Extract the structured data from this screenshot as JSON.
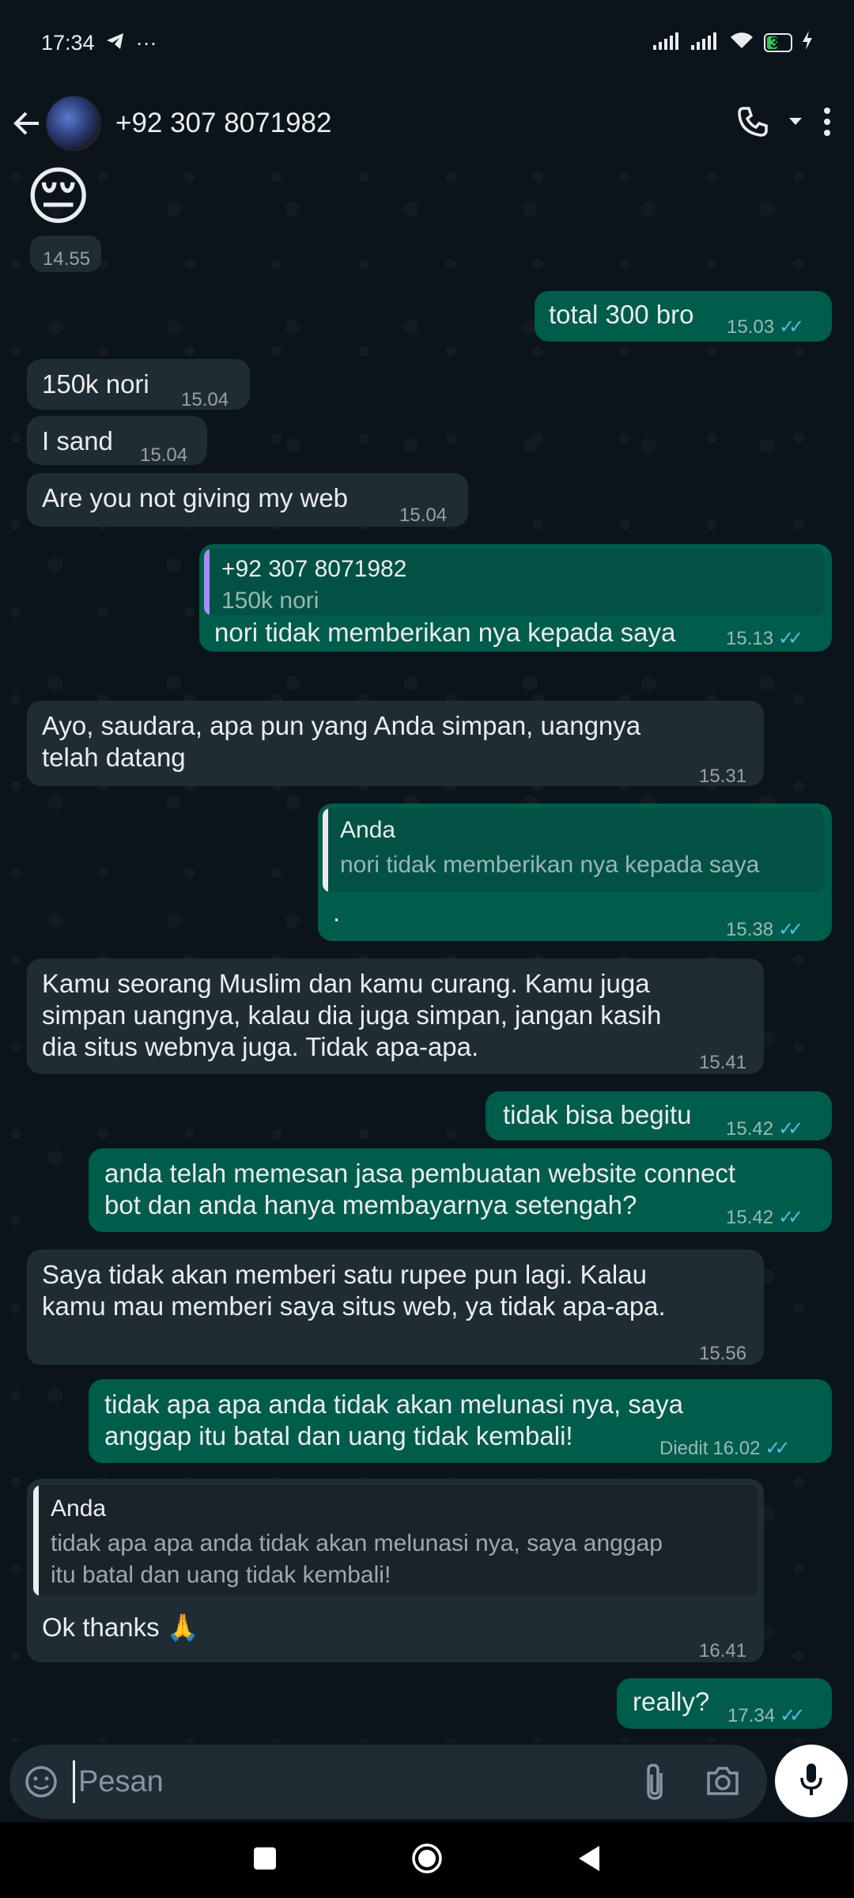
{
  "status": {
    "time": "17:34",
    "more": "···",
    "battery": "33"
  },
  "header": {
    "contact": "+92 307 8071982"
  },
  "messages": {
    "m0": {
      "emoji": "😔",
      "time": "14.55"
    },
    "m1": {
      "text": "total 300 bro",
      "time": "15.03"
    },
    "m2": {
      "text": "150k nori",
      "time": "15.04"
    },
    "m3": {
      "text": "I sand",
      "time": "15.04"
    },
    "m4": {
      "text": "Are you not giving my web",
      "time": "15.04"
    },
    "m5": {
      "quote_author": "+92 307 8071982",
      "quote_text": "150k nori",
      "text": "nori tidak memberikan nya kepada saya",
      "time": "15.13"
    },
    "m6": {
      "text": "Ayo, saudara, apa pun yang Anda simpan, uangnya\ntelah datang",
      "time": "15.31"
    },
    "m7": {
      "quote_author": "Anda",
      "quote_text": "nori tidak memberikan nya kepada saya",
      "text": ".",
      "time": "15.38"
    },
    "m8": {
      "text": "Kamu seorang Muslim dan kamu curang. Kamu juga\nsimpan uangnya, kalau dia juga simpan, jangan kasih\ndia situs webnya juga. Tidak apa-apa.",
      "time": "15.41"
    },
    "m9": {
      "text": "tidak bisa begitu",
      "time": "15.42"
    },
    "m10": {
      "text": "anda telah memesan jasa pembuatan website connect\nbot dan anda hanya membayarnya setengah?",
      "time": "15.42"
    },
    "m11": {
      "text": "Saya tidak akan memberi satu rupee pun lagi. Kalau\nkamu mau memberi saya situs web, ya tidak apa-apa.",
      "time": "15.56"
    },
    "m12": {
      "text": "tidak apa apa anda tidak akan melunasi nya, saya\nanggap itu batal dan uang tidak kembali!",
      "edited": "Diedit",
      "time": "16.02"
    },
    "m13": {
      "quote_author": "Anda",
      "quote_text": "tidak apa apa anda tidak akan melunasi nya, saya anggap\nitu batal dan uang tidak kembali!",
      "text": "Ok thanks 🙏",
      "time": "16.41"
    },
    "m14": {
      "text": "really?",
      "time": "17.34"
    }
  },
  "input": {
    "placeholder": "Pesan"
  },
  "colors": {
    "incoming": "#202c33",
    "outgoing": "#005c4b",
    "tick": "#53bdeb",
    "quote_other": "#a78bfa",
    "quote_self": "#e9edef"
  }
}
